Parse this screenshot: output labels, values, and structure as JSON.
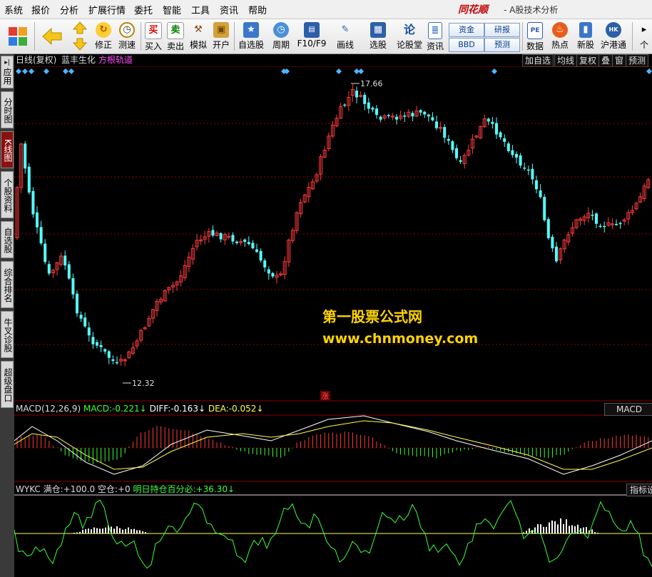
{
  "menu": [
    "系统",
    "报价",
    "分析",
    "扩展行情",
    "委托",
    "智能",
    "工具",
    "资讯",
    "帮助"
  ],
  "app": {
    "logo": "同花顺",
    "title": "- A股技术分析"
  },
  "toolbar": {
    "buttons": [
      {
        "label": "修正",
        "icon": "refresh-icon"
      },
      {
        "label": "测速",
        "icon": "clock-icon"
      },
      {
        "label": "买入",
        "icon": "buy-icon",
        "glyph": "买"
      },
      {
        "label": "卖出",
        "icon": "sell-icon",
        "glyph": "卖"
      },
      {
        "label": "模拟",
        "icon": "hammer-icon"
      },
      {
        "label": "开户",
        "icon": "lock-icon"
      },
      {
        "label": "自选股",
        "icon": "star-icon"
      },
      {
        "label": "周期",
        "icon": "clock-icon"
      },
      {
        "label": "F10/F9",
        "icon": "f10-icon"
      },
      {
        "label": "画线",
        "icon": "pencil-icon"
      },
      {
        "label": "选股",
        "icon": "screen-icon"
      },
      {
        "label": "论股堂",
        "icon": "lun-icon",
        "glyph": "论"
      },
      {
        "label": "资讯",
        "icon": "doc-icon"
      },
      {
        "label": "数据",
        "icon": "pe-icon",
        "glyph": "PE"
      },
      {
        "label": "热点",
        "icon": "hot-icon"
      },
      {
        "label": "新股",
        "icon": "new-stock-icon"
      },
      {
        "label": "沪港通",
        "icon": "sse-hke-icon"
      }
    ],
    "boxes": [
      "资金",
      "研报",
      "BBD",
      "预测"
    ],
    "more": "个"
  },
  "sidebar": [
    "应用",
    "分时图",
    "K线图",
    "个股资料",
    "自选股",
    "综合排名",
    "牛叉诊股",
    "超级盘口"
  ],
  "chart_header": {
    "period": "日线(复权)",
    "stock": "蓝丰生化",
    "indicator": "方根轨道",
    "buttons": [
      "加自选",
      "均线",
      "复权",
      "叠",
      "窗",
      "预测"
    ]
  },
  "chart_data": [
    {
      "type": "candlestick",
      "title": "日线(复权) 蓝丰生化",
      "annotations": {
        "high": "17.66",
        "low": "12.32",
        "marker": "涨"
      },
      "high_value": 17.66,
      "low_value": 12.32,
      "bars": 160
    },
    {
      "type": "line",
      "title": "MACD(12,26,9)",
      "series": [
        {
          "name": "MACD",
          "value": "-0.221"
        },
        {
          "name": "DIFF",
          "value": "-0.163"
        },
        {
          "name": "DEA",
          "value": "-0.052"
        }
      ]
    },
    {
      "type": "line",
      "title": "WYKC",
      "series": [
        {
          "name": "满仓",
          "value": "+100.0"
        },
        {
          "name": "空仓",
          "value": "+0"
        },
        {
          "name": "明日持仓百分必",
          "value": "+36.30"
        }
      ]
    }
  ],
  "macd_header": {
    "name": "MACD(12,26,9)",
    "macd_label": "MACD:",
    "macd_val": "-0.221",
    "diff_label": "DIFF:",
    "diff_val": "-0.163",
    "dea_label": "DEA:",
    "dea_val": "-0.052",
    "arrow": "↓",
    "tab": "MACD"
  },
  "wykc_header": {
    "name": "WYKC",
    "full_label": "满仓:",
    "full_val": "+100.0",
    "empty_label": "空仓:",
    "empty_val": "+0",
    "pct_label": "明日持仓百分必:",
    "pct_val": "+36.30",
    "arrow": "↓",
    "tab": "指标设"
  },
  "watermark": {
    "line1": "第一股票公式网",
    "line2": "www.chnmoney.com"
  },
  "colors": {
    "up": "#ff3b3b",
    "down": "#54ffff",
    "yellow": "#ffff4a",
    "green": "#3cff3c",
    "grid": "#8b0000"
  }
}
